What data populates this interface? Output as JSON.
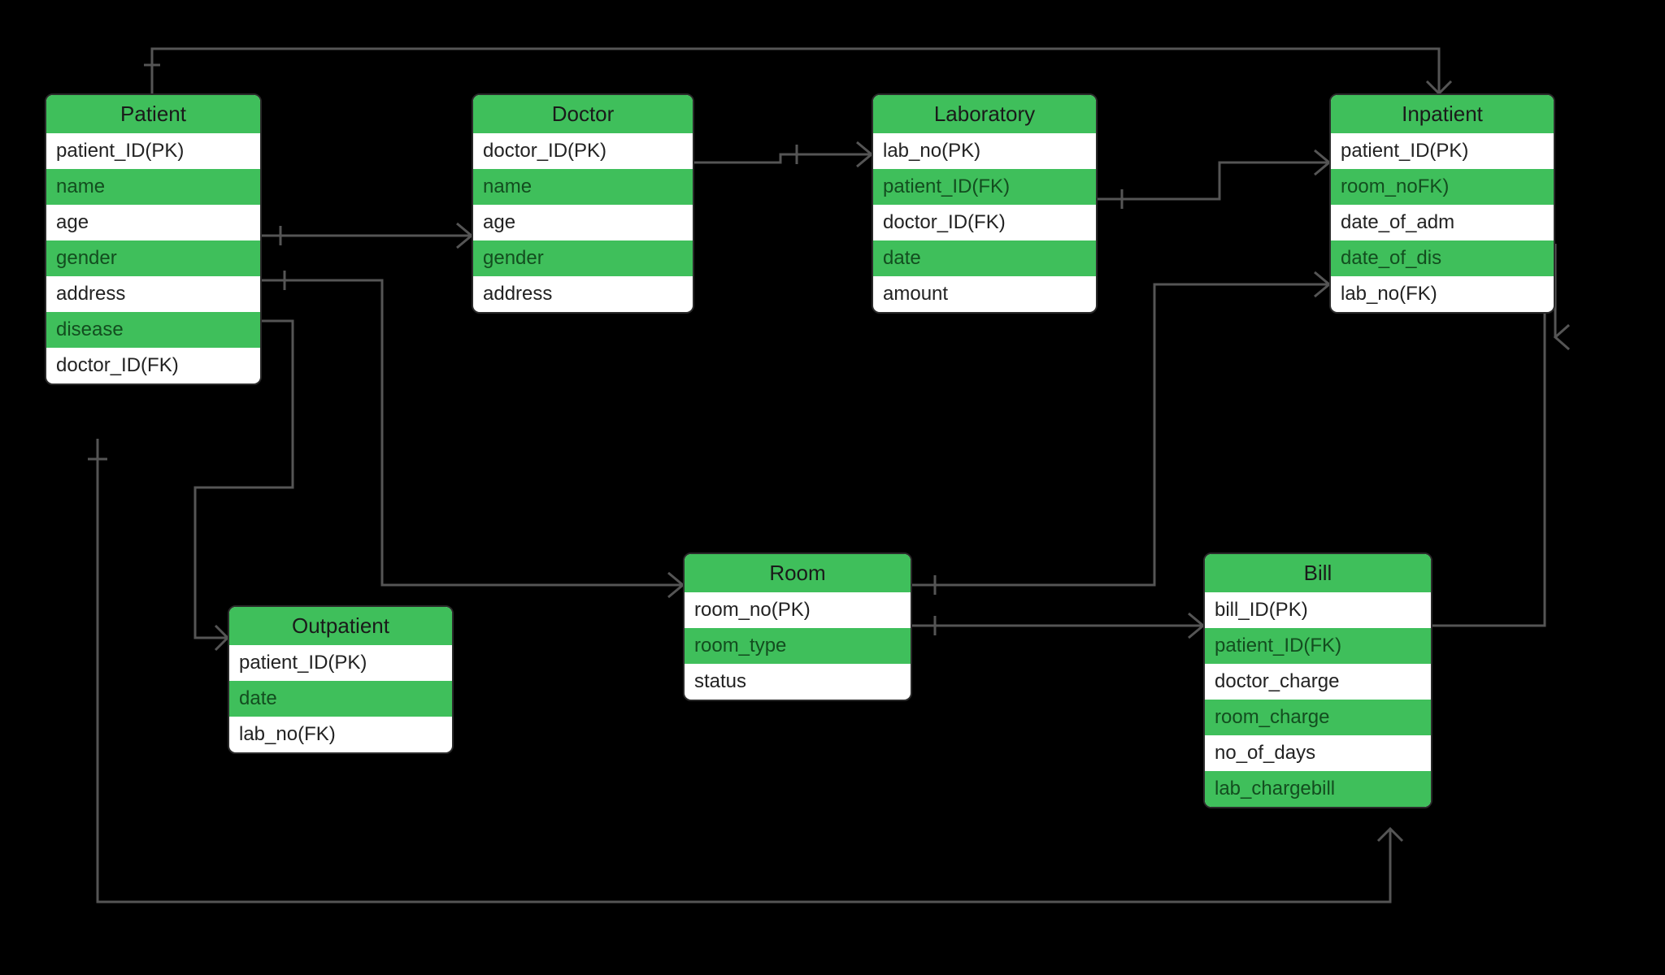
{
  "entities": {
    "patient": {
      "title": "Patient",
      "rows": [
        "patient_ID(PK)",
        "name",
        "age",
        "gender",
        "address",
        "disease",
        "doctor_ID(FK)"
      ]
    },
    "doctor": {
      "title": "Doctor",
      "rows": [
        "doctor_ID(PK)",
        "name",
        "age",
        "gender",
        "address"
      ]
    },
    "laboratory": {
      "title": "Laboratory",
      "rows": [
        "lab_no(PK)",
        "patient_ID(FK)",
        "doctor_ID(FK)",
        "date",
        "amount"
      ]
    },
    "inpatient": {
      "title": "Inpatient",
      "rows": [
        "patient_ID(PK)",
        "room_noFK)",
        "date_of_adm",
        "date_of_dis",
        "lab_no(FK)"
      ]
    },
    "outpatient": {
      "title": "Outpatient",
      "rows": [
        "patient_ID(PK)",
        "date",
        "lab_no(FK)"
      ]
    },
    "room": {
      "title": "Room",
      "rows": [
        "room_no(PK)",
        "room_type",
        "status"
      ]
    },
    "bill": {
      "title": "Bill",
      "rows": [
        "bill_ID(PK)",
        "patient_ID(FK)",
        "doctor_charge",
        "room_charge",
        "no_of_days",
        "lab_chargebill"
      ]
    }
  },
  "colors": {
    "header": "#3fbf5b",
    "connector": "#4a4a4a"
  }
}
